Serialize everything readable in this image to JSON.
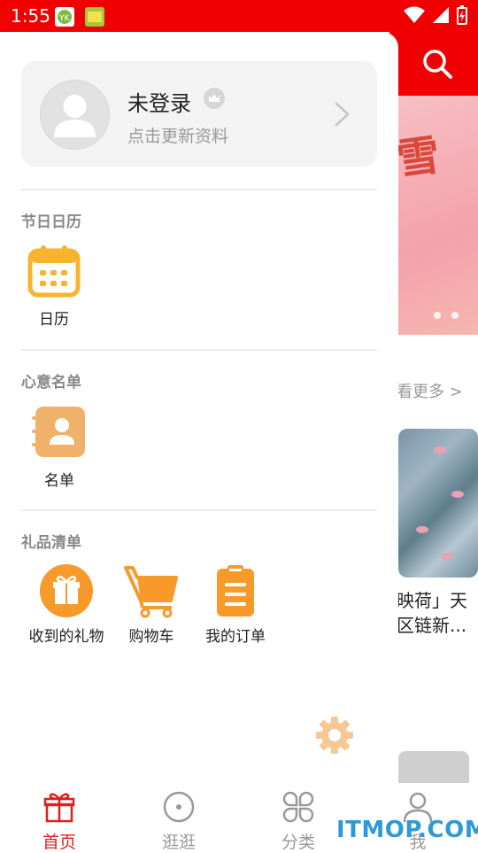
{
  "status_bar": {
    "time": "1:55"
  },
  "background_page": {
    "more_link": "看更多 >",
    "card_title_line1": "映荷」天",
    "card_title_line2": "区链新..."
  },
  "drawer": {
    "profile": {
      "name": "未登录",
      "subtitle": "点击更新资料"
    },
    "sections": [
      {
        "title": "节日日历",
        "items": [
          {
            "label": "日历",
            "icon": "calendar-icon"
          }
        ]
      },
      {
        "title": "心意名单",
        "items": [
          {
            "label": "名单",
            "icon": "contact-book-icon"
          }
        ]
      },
      {
        "title": "礼品清单",
        "items": [
          {
            "label": "收到的礼物",
            "icon": "gift-icon"
          },
          {
            "label": "购物车",
            "icon": "cart-icon"
          },
          {
            "label": "我的订单",
            "icon": "order-clipboard-icon"
          }
        ]
      }
    ]
  },
  "bottom_nav": {
    "tabs": [
      {
        "label": "首页",
        "icon": "gift-icon",
        "active": true
      },
      {
        "label": "逛逛",
        "icon": "compass-icon",
        "active": false
      },
      {
        "label": "分类",
        "icon": "grid-icon",
        "active": false
      },
      {
        "label": "我",
        "icon": "user-icon",
        "active": false
      }
    ]
  },
  "watermark": "ITMOP.COM",
  "colors": {
    "brand_red": "#f00000",
    "accent_orange": "#f79a2a",
    "calendar_yellow": "#f7b42c",
    "contact_tan": "#f0b26a",
    "settings_gear": "#f5c896"
  }
}
